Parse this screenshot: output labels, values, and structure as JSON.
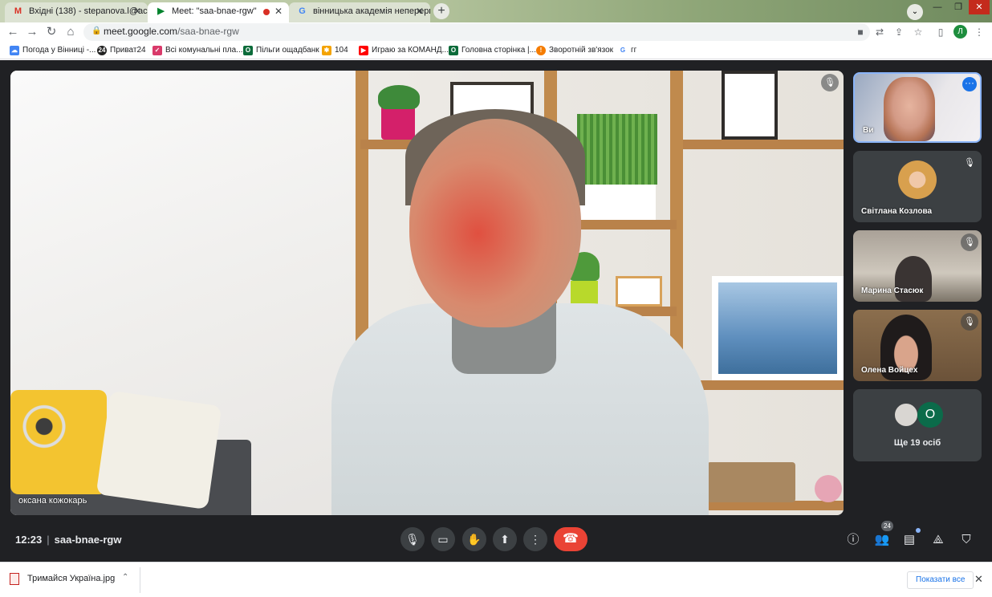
{
  "browser": {
    "tabs": [
      {
        "title": "Вхідні (138) - stepanova.l@acade",
        "favicon": "gmail-icon",
        "active": false
      },
      {
        "title": "Meet: \"saa-bnae-rgw\"",
        "favicon": "meet-icon",
        "active": true,
        "recording": true
      },
      {
        "title": "вінницька академія неперервн",
        "favicon": "google-icon",
        "active": false
      }
    ],
    "url_host": "meet.google.com",
    "url_path": "/saa-bnae-rgw",
    "profile_initial": "Л",
    "bookmarks": [
      {
        "label": "Погода у Вінниці -...",
        "color": "#4285f4"
      },
      {
        "label": "Приват24",
        "color": "#222222",
        "glyph": "24"
      },
      {
        "label": "Всі комунальні пла...",
        "color": "#d93a6a"
      },
      {
        "label": "Пільги ощадбанк",
        "color": "#0b6b3a",
        "glyph": "O"
      },
      {
        "label": "104",
        "color": "#f4a300"
      },
      {
        "label": "Играю за КОМАНД...",
        "color": "#ff0000"
      },
      {
        "label": "Головна сторінка |...",
        "color": "#0b6b3a",
        "glyph": "O"
      },
      {
        "label": "Зворотній зв'язок",
        "color": "#f57c00"
      },
      {
        "label": "гг",
        "color": "#4285f4",
        "glyph": "G"
      }
    ]
  },
  "meet": {
    "main_participant": "оксана кожокарь",
    "participants": [
      {
        "name": "Ви"
      },
      {
        "name": "Світлана Козлова"
      },
      {
        "name": "Марина Стасюк"
      },
      {
        "name": "Олена Войцех"
      }
    ],
    "others": {
      "label": "Ще 19 осіб",
      "avatar_initial": "О"
    },
    "time": "12:23",
    "meeting_code": "saa-bnae-rgw",
    "people_count": "24",
    "accent": "#8ab4f8",
    "hangup_color": "#ea4335"
  },
  "downloads": {
    "file": "Тримайся Україна.jpg",
    "show_all": "Показати все"
  }
}
